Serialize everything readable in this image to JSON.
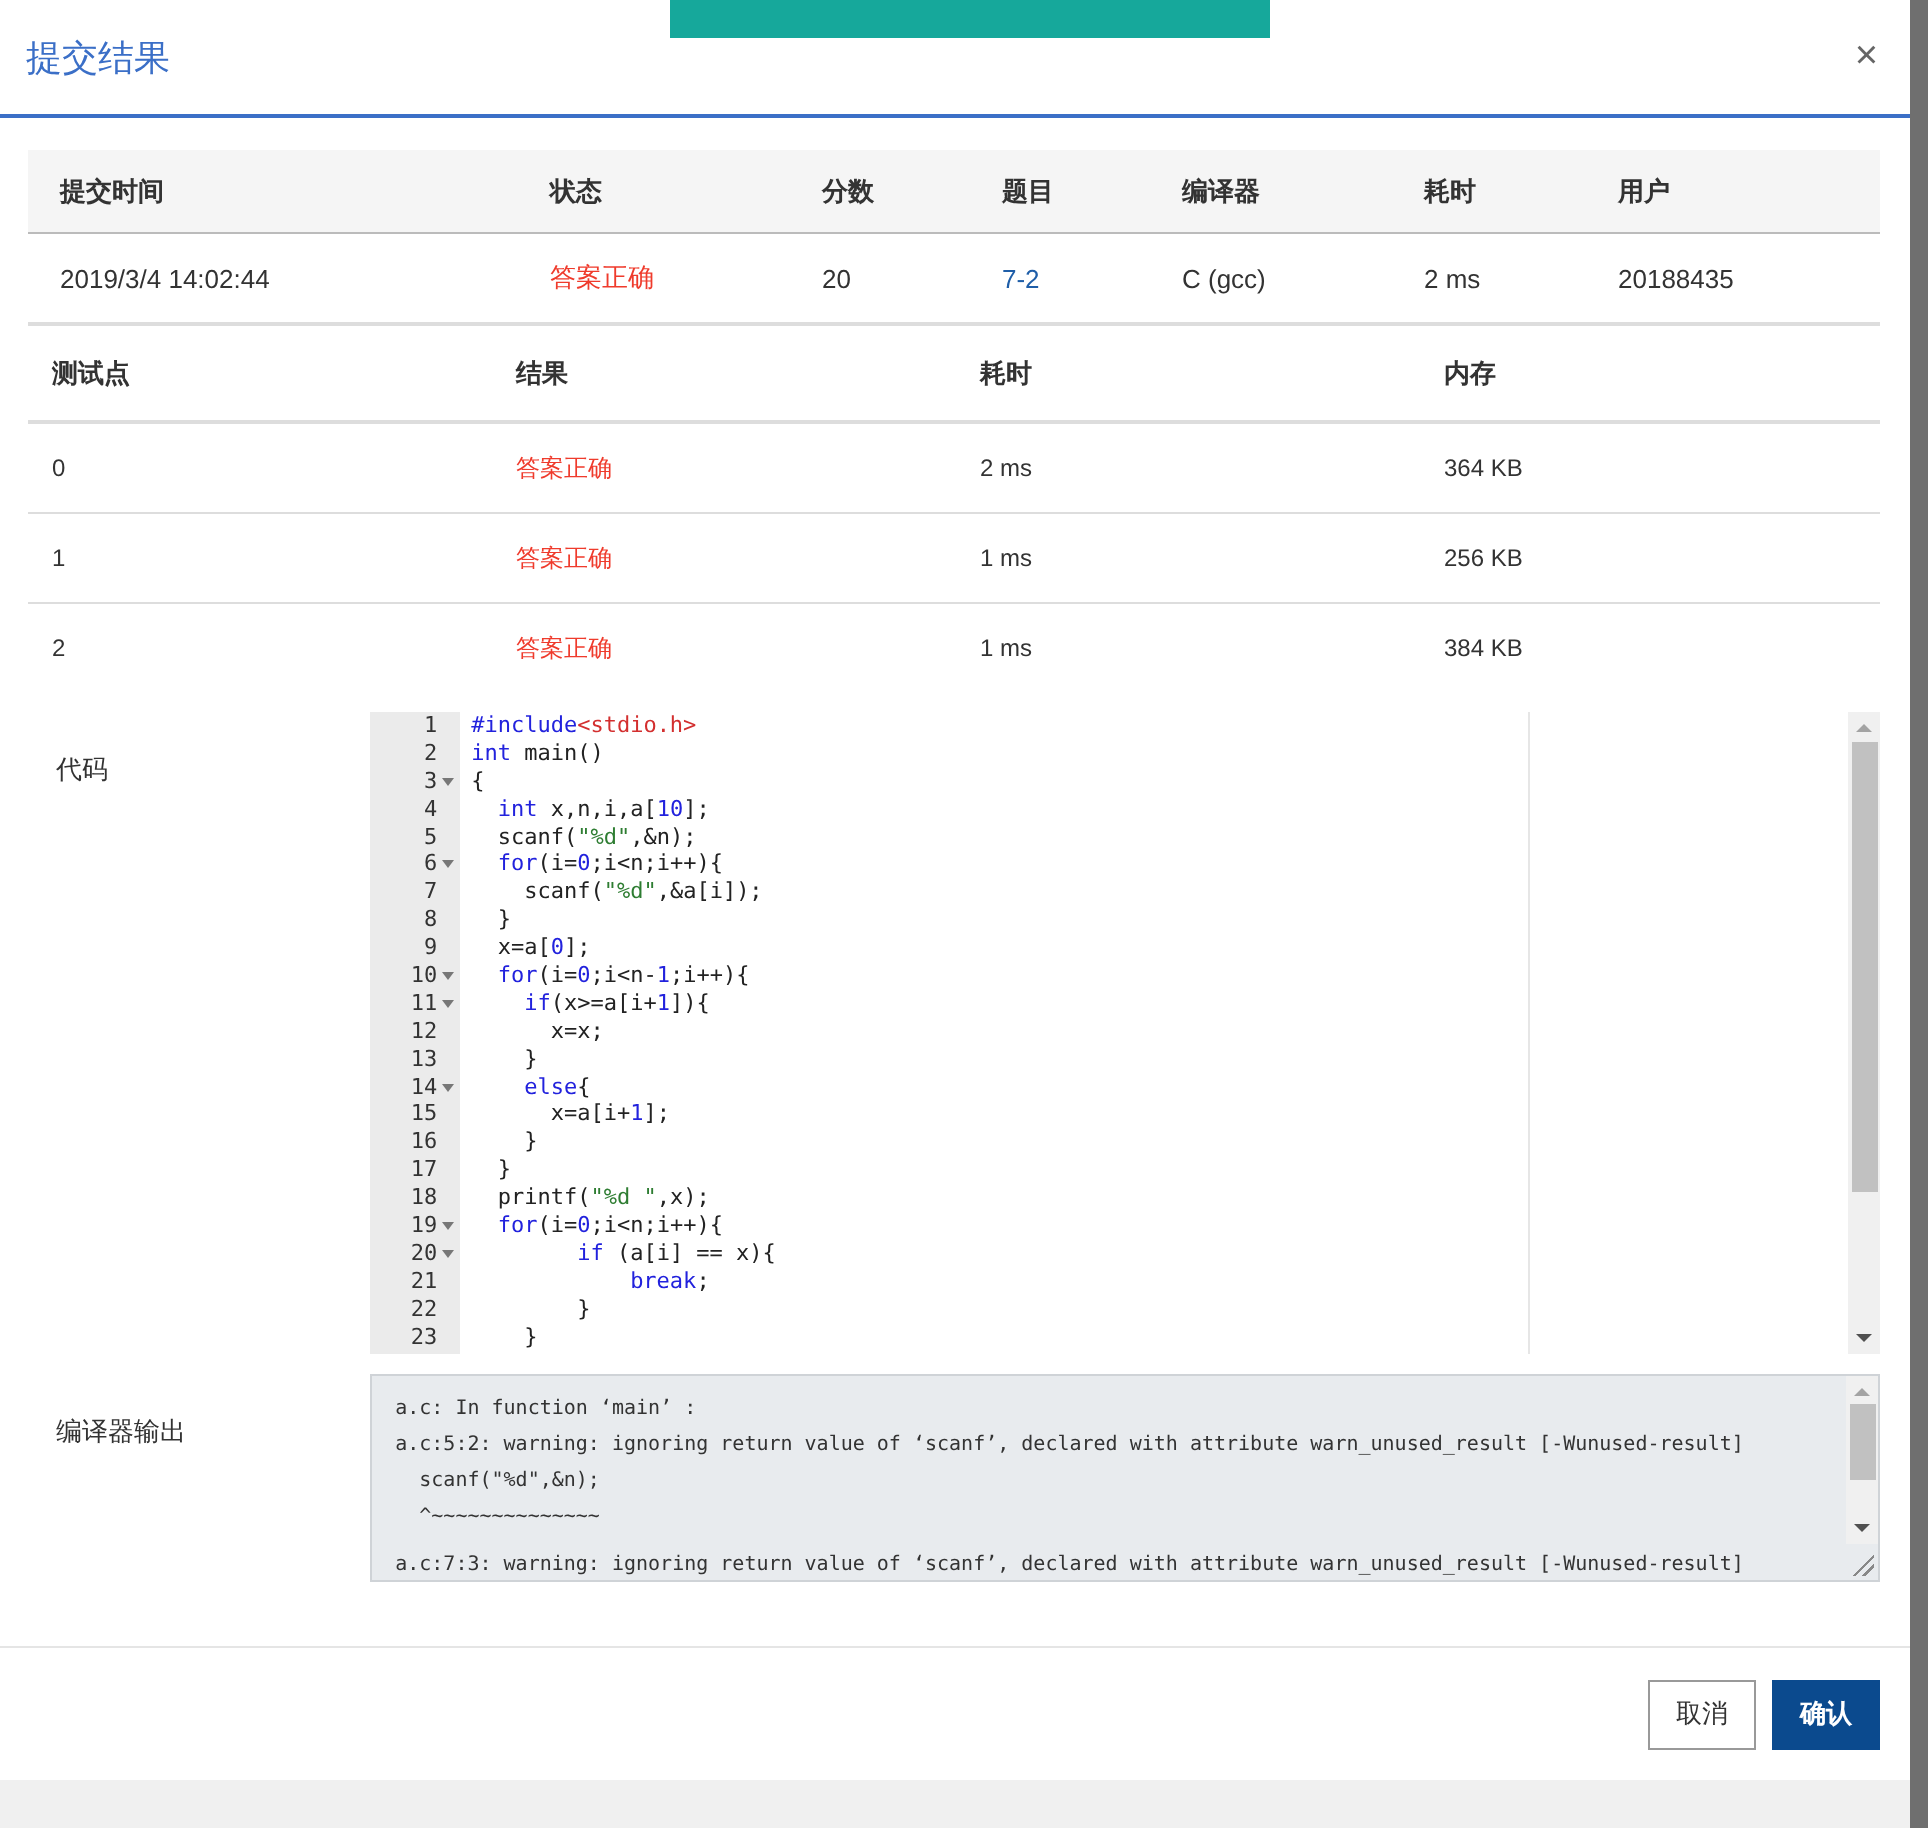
{
  "toast": {
    "kind": "success"
  },
  "dialog": {
    "title": "提交结果",
    "close": "×"
  },
  "summary": {
    "columns": [
      "提交时间",
      "状态",
      "分数",
      "题目",
      "编译器",
      "耗时",
      "用户"
    ],
    "row": [
      {
        "text": "2019/3/4 14:02:44",
        "kind": "plain"
      },
      {
        "text": "答案正确",
        "kind": "status"
      },
      {
        "text": "20",
        "kind": "plain"
      },
      {
        "text": "7-2",
        "kind": "link"
      },
      {
        "text": "C (gcc)",
        "kind": "plain"
      },
      {
        "text": "2 ms",
        "kind": "plain"
      },
      {
        "text": "20188435",
        "kind": "plain"
      }
    ]
  },
  "tests": {
    "columns": [
      "测试点",
      "结果",
      "耗时",
      "内存"
    ],
    "rows": [
      [
        "0",
        "答案正确",
        "2 ms",
        "364 KB"
      ],
      [
        "1",
        "答案正确",
        "1 ms",
        "256 KB"
      ],
      [
        "2",
        "答案正确",
        "1 ms",
        "384 KB"
      ]
    ]
  },
  "code": {
    "label": "代码",
    "lines": [
      {
        "n": "1",
        "fold": false,
        "tokens": [
          {
            "text": "#include",
            "kind": "kw"
          },
          {
            "text": "<stdio.h>",
            "kind": "inc"
          }
        ]
      },
      {
        "n": "2",
        "fold": false,
        "tokens": [
          {
            "text": "int",
            "kind": "kw"
          },
          {
            "text": " main()",
            "kind": "plain"
          }
        ]
      },
      {
        "n": "3",
        "fold": true,
        "tokens": [
          {
            "text": "{",
            "kind": "plain"
          }
        ]
      },
      {
        "n": "4",
        "fold": false,
        "tokens": [
          {
            "text": "  int",
            "kind": "kw"
          },
          {
            "text": " x,n,i,a[",
            "kind": "plain"
          },
          {
            "text": "10",
            "kind": "num"
          },
          {
            "text": "];",
            "kind": "plain"
          }
        ]
      },
      {
        "n": "5",
        "fold": false,
        "tokens": [
          {
            "text": "  scanf(",
            "kind": "plain"
          },
          {
            "text": "\"%d\"",
            "kind": "str"
          },
          {
            "text": ",&n);",
            "kind": "plain"
          }
        ]
      },
      {
        "n": "6",
        "fold": true,
        "tokens": [
          {
            "text": "  for",
            "kind": "kw"
          },
          {
            "text": "(i=",
            "kind": "plain"
          },
          {
            "text": "0",
            "kind": "num"
          },
          {
            "text": ";i<n;i++){",
            "kind": "plain"
          }
        ]
      },
      {
        "n": "7",
        "fold": false,
        "tokens": [
          {
            "text": "    scanf(",
            "kind": "plain"
          },
          {
            "text": "\"%d\"",
            "kind": "str"
          },
          {
            "text": ",&a[i]);",
            "kind": "plain"
          }
        ]
      },
      {
        "n": "8",
        "fold": false,
        "tokens": [
          {
            "text": "  }",
            "kind": "plain"
          }
        ]
      },
      {
        "n": "9",
        "fold": false,
        "tokens": [
          {
            "text": "  x=a[",
            "kind": "plain"
          },
          {
            "text": "0",
            "kind": "num"
          },
          {
            "text": "];",
            "kind": "plain"
          }
        ]
      },
      {
        "n": "10",
        "fold": true,
        "tokens": [
          {
            "text": "  for",
            "kind": "kw"
          },
          {
            "text": "(i=",
            "kind": "plain"
          },
          {
            "text": "0",
            "kind": "num"
          },
          {
            "text": ";i<n-",
            "kind": "plain"
          },
          {
            "text": "1",
            "kind": "num"
          },
          {
            "text": ";i++){",
            "kind": "plain"
          }
        ]
      },
      {
        "n": "11",
        "fold": true,
        "tokens": [
          {
            "text": "    if",
            "kind": "kw"
          },
          {
            "text": "(x>=a[i+",
            "kind": "plain"
          },
          {
            "text": "1",
            "kind": "num"
          },
          {
            "text": "]){",
            "kind": "plain"
          }
        ]
      },
      {
        "n": "12",
        "fold": false,
        "tokens": [
          {
            "text": "      x=x;",
            "kind": "plain"
          }
        ]
      },
      {
        "n": "13",
        "fold": false,
        "tokens": [
          {
            "text": "    }",
            "kind": "plain"
          }
        ]
      },
      {
        "n": "14",
        "fold": true,
        "tokens": [
          {
            "text": "    else",
            "kind": "kw"
          },
          {
            "text": "{",
            "kind": "plain"
          }
        ]
      },
      {
        "n": "15",
        "fold": false,
        "tokens": [
          {
            "text": "      x=a[i+",
            "kind": "plain"
          },
          {
            "text": "1",
            "kind": "num"
          },
          {
            "text": "];",
            "kind": "plain"
          }
        ]
      },
      {
        "n": "16",
        "fold": false,
        "tokens": [
          {
            "text": "    }",
            "kind": "plain"
          }
        ]
      },
      {
        "n": "17",
        "fold": false,
        "tokens": [
          {
            "text": "  }",
            "kind": "plain"
          }
        ]
      },
      {
        "n": "18",
        "fold": false,
        "tokens": [
          {
            "text": "  printf(",
            "kind": "plain"
          },
          {
            "text": "\"%d \"",
            "kind": "str"
          },
          {
            "text": ",x);",
            "kind": "plain"
          }
        ]
      },
      {
        "n": "19",
        "fold": true,
        "tokens": [
          {
            "text": "  for",
            "kind": "kw"
          },
          {
            "text": "(i=",
            "kind": "plain"
          },
          {
            "text": "0",
            "kind": "num"
          },
          {
            "text": ";i<n;i++){",
            "kind": "plain"
          }
        ]
      },
      {
        "n": "20",
        "fold": true,
        "tokens": [
          {
            "text": "        if",
            "kind": "kw"
          },
          {
            "text": " (a[i] == x){",
            "kind": "plain"
          }
        ]
      },
      {
        "n": "21",
        "fold": false,
        "tokens": [
          {
            "text": "            break",
            "kind": "kw"
          },
          {
            "text": ";",
            "kind": "plain"
          }
        ]
      },
      {
        "n": "22",
        "fold": false,
        "tokens": [
          {
            "text": "        }",
            "kind": "plain"
          }
        ]
      },
      {
        "n": "23",
        "fold": false,
        "tokens": [
          {
            "text": "    }",
            "kind": "plain"
          }
        ]
      }
    ]
  },
  "compiler_output": {
    "label": "编译器输出",
    "lines": [
      "a.c: In function ‘main’ :",
      "a.c:5:2: warning: ignoring return value of ‘scanf’, declared with attribute warn_unused_result [-Wunused-result]",
      "  scanf(\"%d\",&n);",
      "  ^~~~~~~~~~~~~~~",
      "a.c:7:3: warning: ignoring return value of ‘scanf’, declared with attribute warn_unused_result [-Wunused-result]"
    ]
  },
  "buttons": [
    {
      "label": "取消",
      "kind": "secondary"
    },
    {
      "label": "确认",
      "kind": "primary"
    }
  ]
}
